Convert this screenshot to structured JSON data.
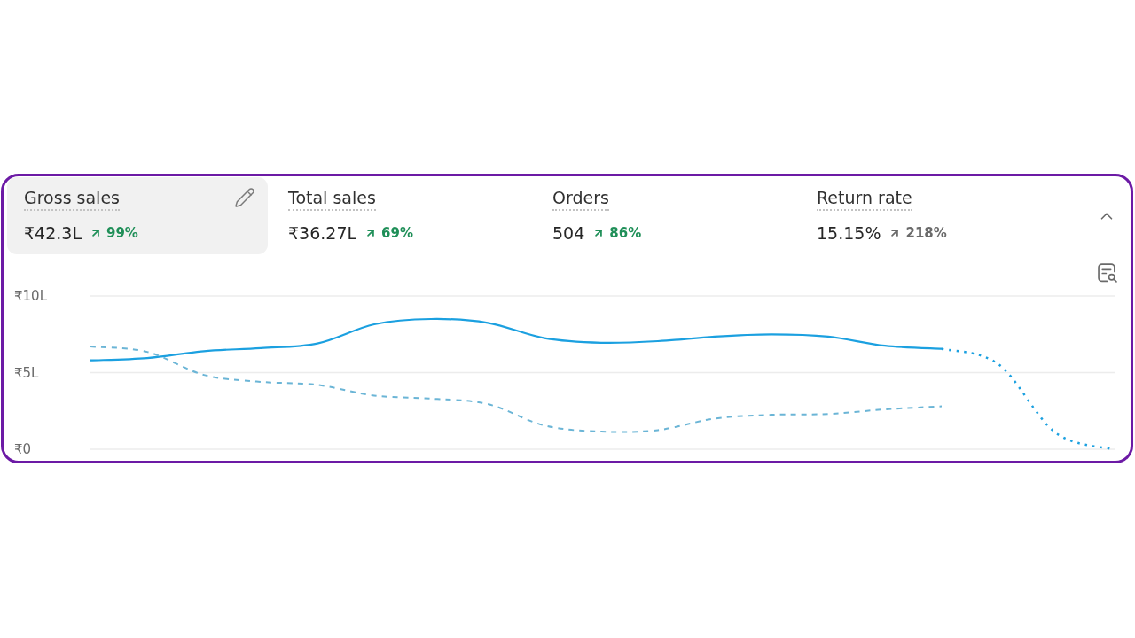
{
  "metrics": [
    {
      "title": "Gross sales",
      "value": "₹42.3L",
      "change": "99%",
      "color": "#1f8f58",
      "selected": true
    },
    {
      "title": "Total sales",
      "value": "₹36.27L",
      "change": "69%",
      "color": "#1f8f58",
      "selected": false
    },
    {
      "title": "Orders",
      "value": "504",
      "change": "86%",
      "color": "#1f8f58",
      "selected": false
    },
    {
      "title": "Return rate",
      "value": "15.15%",
      "change": "218%",
      "color": "#6a6a6a",
      "selected": false
    }
  ],
  "panel": {
    "expanded": true
  },
  "chart": {
    "chart_data": {
      "type": "line",
      "ylim": [
        0,
        10
      ],
      "yticks": [
        {
          "value": 10,
          "label": "₹10L"
        },
        {
          "value": 5,
          "label": "₹5L"
        },
        {
          "value": 0,
          "label": "₹0"
        }
      ],
      "series": [
        {
          "line_style": "solid",
          "color": "#1ba0e0",
          "values": [
            5.8,
            5.95,
            6.4,
            6.6,
            6.9,
            8.15,
            8.5,
            8.25,
            7.25,
            6.95,
            7.05,
            7.35,
            7.5,
            7.35,
            6.75,
            6.55,
            null,
            null,
            null
          ]
        },
        {
          "line_style": "dotted",
          "color": "#1ba0e0",
          "values": [
            null,
            null,
            null,
            null,
            null,
            null,
            null,
            null,
            null,
            null,
            null,
            null,
            null,
            null,
            null,
            6.55,
            5.55,
            1.1,
            0
          ]
        },
        {
          "line_style": "dashed",
          "color": "#6bb5d6",
          "values": [
            6.7,
            6.35,
            4.85,
            4.4,
            4.2,
            3.5,
            3.3,
            2.95,
            1.55,
            1.15,
            1.25,
            2.0,
            2.25,
            2.3,
            2.6,
            2.8,
            null,
            null,
            null
          ]
        }
      ]
    }
  }
}
